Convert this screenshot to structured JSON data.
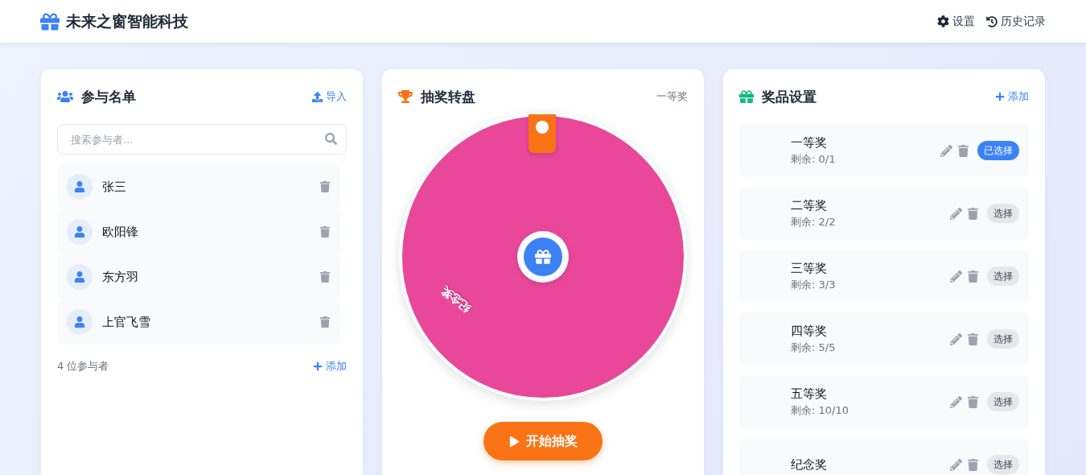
{
  "header": {
    "title": "未来之窗智能科技",
    "actions": [
      {
        "label": "设置",
        "kind": "settings"
      },
      {
        "label": "历史记录",
        "kind": "history"
      }
    ]
  },
  "participants": {
    "title": "参与名单",
    "import_label": "导入",
    "search": {
      "placeholder": "搜索参与者..."
    },
    "people": [
      {
        "name": "张三"
      },
      {
        "name": "欧阳锋"
      },
      {
        "name": "东方羽"
      },
      {
        "name": "上官飞雪"
      }
    ],
    "count": "4 位参与者",
    "add_label": "添加"
  },
  "wheel": {
    "title": "抽奖转盘",
    "current_prize": "一等奖",
    "segment_label": "纪念奖",
    "start_label": "开始抽奖"
  },
  "prizes": {
    "title": "奖品设置",
    "add_label": "添加",
    "items": [
      {
        "name": "一等奖",
        "remaining": "剩余: 0/1",
        "selected": true,
        "button": "已选择"
      },
      {
        "name": "二等奖",
        "remaining": "剩余: 2/2",
        "selected": false,
        "button": "选择"
      },
      {
        "name": "三等奖",
        "remaining": "剩余: 3/3",
        "selected": false,
        "button": "选择"
      },
      {
        "name": "四等奖",
        "remaining": "剩余: 5/5",
        "selected": false,
        "button": "选择"
      },
      {
        "name": "五等奖",
        "remaining": "剩余: 10/10",
        "selected": false,
        "button": "选择"
      },
      {
        "name": "纪念奖",
        "selected": false,
        "button": "选择"
      }
    ]
  }
}
